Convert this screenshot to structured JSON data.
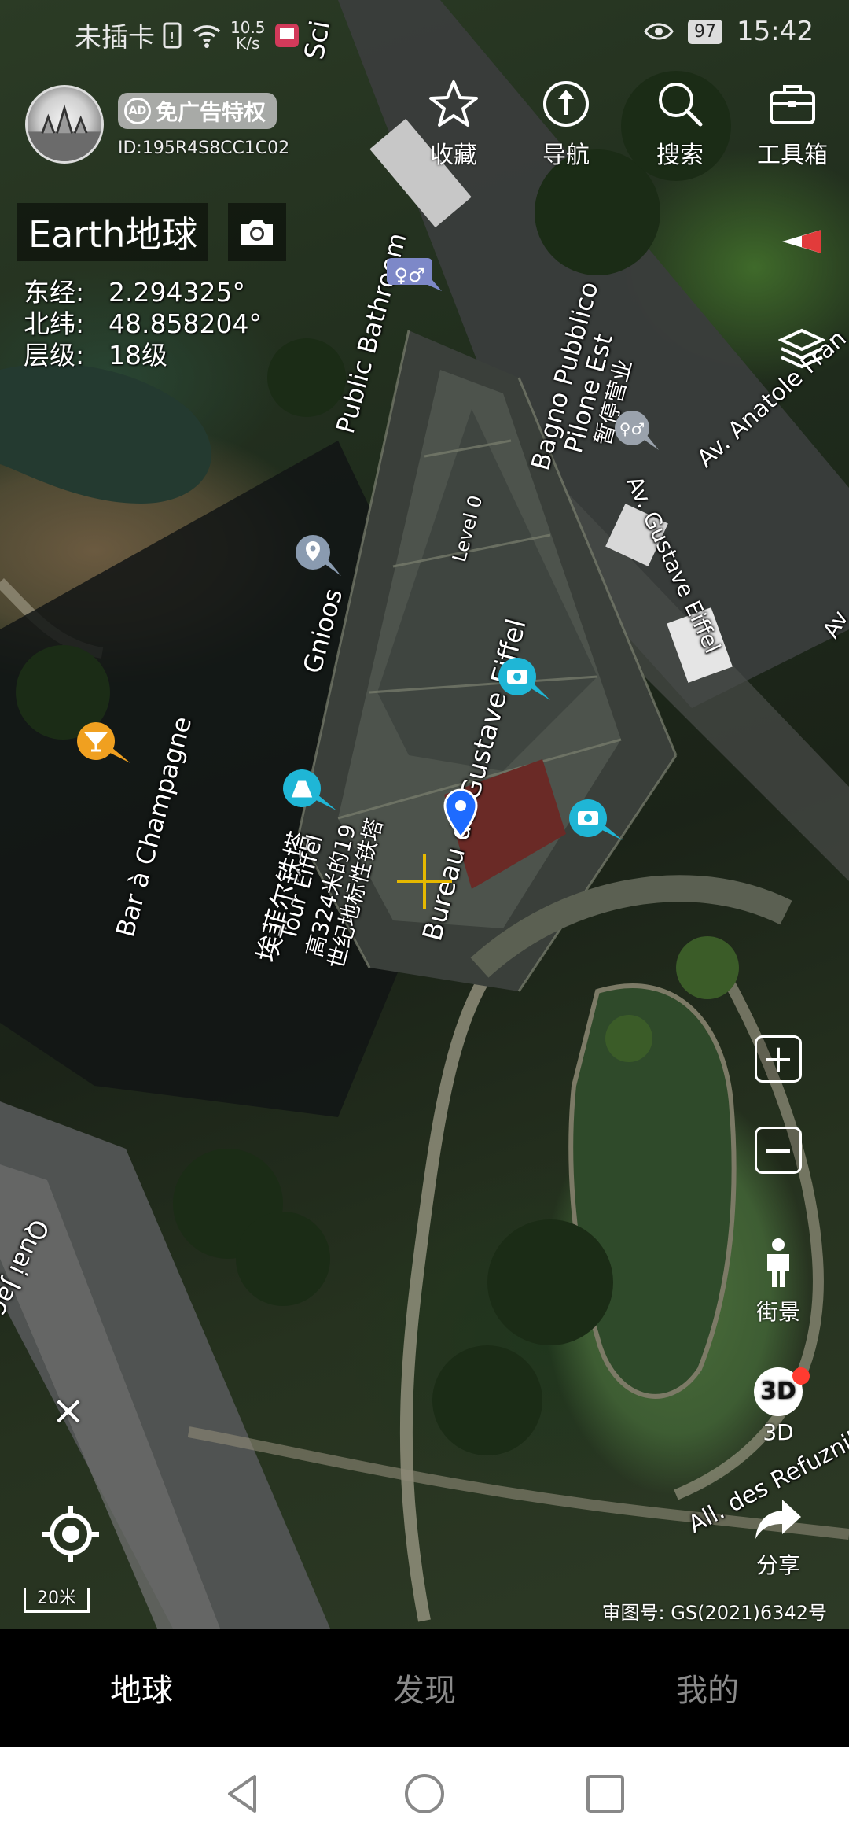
{
  "status_bar": {
    "carrier": "未插卡",
    "speed_value": "10.5",
    "speed_unit": "K/s",
    "battery": "97",
    "time": "15:42"
  },
  "header": {
    "ad_badge_icon": "AD",
    "ad_badge_label": "免广告特权",
    "user_id": "ID:195R4S8CC1C02",
    "buttons": [
      {
        "label": "收藏",
        "icon": "star-icon"
      },
      {
        "label": "导航",
        "icon": "navigation-icon"
      },
      {
        "label": "搜索",
        "icon": "search-icon"
      },
      {
        "label": "工具箱",
        "icon": "toolbox-icon"
      }
    ]
  },
  "info": {
    "app_title": "Earth地球",
    "lon_label": "东经:",
    "lon_value": "2.294325°",
    "lat_label": "北纬:",
    "lat_value": "48.858204°",
    "level_label": "层级:",
    "level_value": "18级"
  },
  "map_labels": {
    "sci": "Sci",
    "public_bathroom": "Public Bathroom",
    "bagno_1": "Bagno Pubblico",
    "bagno_2": "Pilone Est",
    "bagno_3": "暂停营业",
    "av_anatole": "Av. Anatole Fran",
    "av_gustave": "Av. Gustave Eiffel",
    "level0": "Level 0",
    "gnioos": "Gnioos",
    "bureau": "Bureau de Gustave Eiffel",
    "bar": "Bar à Champagne",
    "tower_cn": "埃菲尔铁塔",
    "tower_en": "Tour Eiffel",
    "tower_d1": "高324米的19",
    "tower_d2": "世纪地标性铁塔",
    "quai": "Quai Jac",
    "refuzniks": "All. des Refuzniks",
    "av_g": "Av"
  },
  "right_tools": {
    "zoom_in": "+",
    "zoom_out": "−",
    "street_view": "街景",
    "three_d_icon": "3D",
    "three_d": "3D",
    "share": "分享"
  },
  "bottom": {
    "close": "×",
    "scale": "20米",
    "approval": "审图号: GS(2021)6342号"
  },
  "tabs": [
    {
      "label": "地球",
      "active": true
    },
    {
      "label": "发现",
      "active": false
    },
    {
      "label": "我的",
      "active": false
    }
  ],
  "colors": {
    "crosshair": "#e6b800",
    "pin_blue": "#1e6bff",
    "poi_teal": "#1fb6d6",
    "poi_orange": "#f0a020",
    "poi_gray": "#8a9bb0"
  }
}
